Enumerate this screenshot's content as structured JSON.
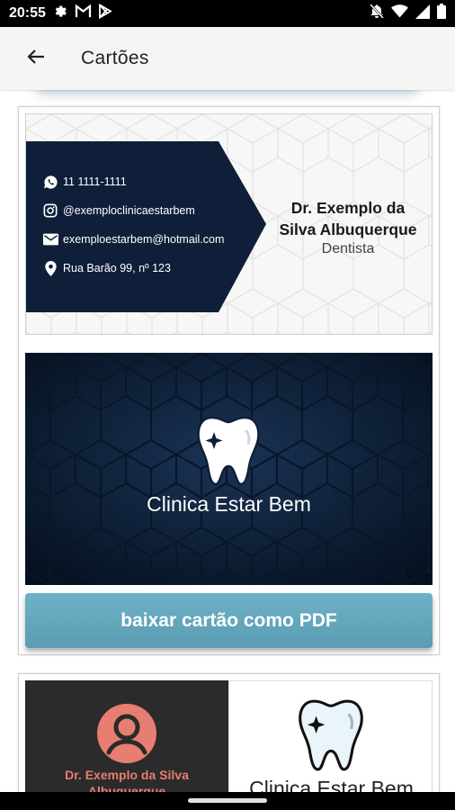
{
  "status_bar": {
    "time": "20:55",
    "left_icons": [
      "gear-icon",
      "gmail-icon",
      "play-store-icon"
    ],
    "right_icons": [
      "notifications-off-icon",
      "wifi-icon",
      "signal-icon",
      "battery-icon"
    ]
  },
  "app_bar": {
    "title": "Cartões",
    "back_icon": "arrow-left-icon"
  },
  "cards": [
    {
      "front": {
        "phone": "11 1111-1111",
        "instagram": "@exemploclinicaestarbem",
        "email": "exemploestarbem@hotmail.com",
        "address": "Rua Barão 99, nº 123",
        "name_line1": "Dr. Exemplo da",
        "name_line2": "Silva Albuquerque",
        "role": "Dentista"
      },
      "back": {
        "clinic_name": "Clinica Estar Bem"
      },
      "download_button": "baixar cartão como PDF"
    },
    {
      "left": {
        "name_line1": "Dr. Exemplo da Silva",
        "name_line2": "Albuquerque"
      },
      "right": {
        "clinic_name": "Clinica Estar Bem"
      }
    }
  ],
  "colors": {
    "navy": "#0f1f3a",
    "button": "#62a6bc",
    "coral": "#e87d72",
    "dark_panel": "#2b2b2b"
  }
}
